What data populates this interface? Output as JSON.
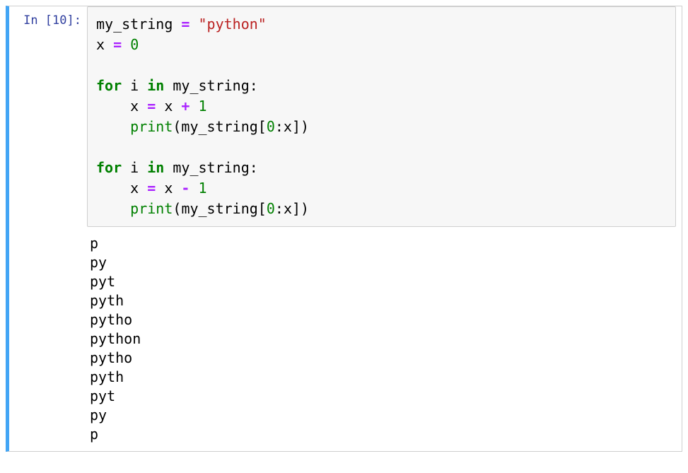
{
  "prompt": {
    "label_prefix": "In [",
    "execution_count": "10",
    "label_suffix": "]:"
  },
  "code": {
    "tokens": [
      {
        "t": "my_string ",
        "c": "tok-name"
      },
      {
        "t": "=",
        "c": "tok-op"
      },
      {
        "t": " ",
        "c": "tok-name"
      },
      {
        "t": "\"python\"",
        "c": "tok-str"
      },
      {
        "t": "\n",
        "c": ""
      },
      {
        "t": "x ",
        "c": "tok-name"
      },
      {
        "t": "=",
        "c": "tok-op"
      },
      {
        "t": " ",
        "c": "tok-name"
      },
      {
        "t": "0",
        "c": "tok-num"
      },
      {
        "t": "\n\n",
        "c": ""
      },
      {
        "t": "for",
        "c": "tok-kw"
      },
      {
        "t": " i ",
        "c": "tok-name"
      },
      {
        "t": "in",
        "c": "tok-kw"
      },
      {
        "t": " my_string:",
        "c": "tok-name"
      },
      {
        "t": "\n    x ",
        "c": "tok-name"
      },
      {
        "t": "=",
        "c": "tok-op"
      },
      {
        "t": " x ",
        "c": "tok-name"
      },
      {
        "t": "+",
        "c": "tok-op"
      },
      {
        "t": " ",
        "c": "tok-name"
      },
      {
        "t": "1",
        "c": "tok-num"
      },
      {
        "t": "\n    ",
        "c": ""
      },
      {
        "t": "print",
        "c": "tok-builtin"
      },
      {
        "t": "(my_string[",
        "c": "tok-punc"
      },
      {
        "t": "0",
        "c": "tok-num"
      },
      {
        "t": ":x])",
        "c": "tok-punc"
      },
      {
        "t": "\n\n",
        "c": ""
      },
      {
        "t": "for",
        "c": "tok-kw"
      },
      {
        "t": " i ",
        "c": "tok-name"
      },
      {
        "t": "in",
        "c": "tok-kw"
      },
      {
        "t": " my_string:",
        "c": "tok-name"
      },
      {
        "t": "\n    x ",
        "c": "tok-name"
      },
      {
        "t": "=",
        "c": "tok-op"
      },
      {
        "t": " x ",
        "c": "tok-name"
      },
      {
        "t": "-",
        "c": "tok-op"
      },
      {
        "t": " ",
        "c": "tok-name"
      },
      {
        "t": "1",
        "c": "tok-num"
      },
      {
        "t": "\n    ",
        "c": ""
      },
      {
        "t": "print",
        "c": "tok-builtin"
      },
      {
        "t": "(",
        "c": "tok-punc"
      },
      {
        "t": "my_string[",
        "c": "tok-name"
      },
      {
        "t": "0",
        "c": "tok-num"
      },
      {
        "t": ":x]",
        "c": "tok-name"
      },
      {
        "t": ")",
        "c": "tok-punc"
      }
    ]
  },
  "output": {
    "lines": [
      "p",
      "py",
      "pyt",
      "pyth",
      "pytho",
      "python",
      "pytho",
      "pyth",
      "pyt",
      "py",
      "p"
    ]
  }
}
